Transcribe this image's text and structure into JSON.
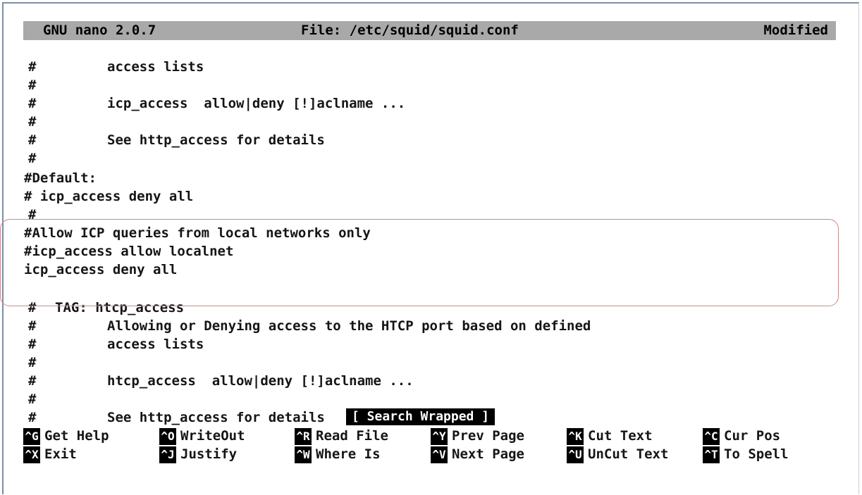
{
  "titlebar": {
    "version": "GNU nano 2.0.7",
    "file": "File: /etc/squid/squid.conf",
    "status": "Modified"
  },
  "lines": [
    {
      "hash": "#",
      "indent": "tab",
      "text": "access lists"
    },
    {
      "hash": "#",
      "indent": "none",
      "text": ""
    },
    {
      "hash": "#",
      "indent": "tab",
      "text": "icp_access  allow|deny [!]aclname ..."
    },
    {
      "hash": "#",
      "indent": "none",
      "text": ""
    },
    {
      "hash": "#",
      "indent": "tab",
      "text": "See http_access for details"
    },
    {
      "hash": "#",
      "indent": "none",
      "text": ""
    },
    {
      "hash": "",
      "indent": "none",
      "text": "#Default:"
    },
    {
      "hash": "",
      "indent": "none",
      "text": "# icp_access deny all"
    },
    {
      "hash": "#",
      "indent": "none",
      "text": ""
    },
    {
      "hash": "",
      "indent": "none",
      "text": "#Allow ICP queries from local networks only"
    },
    {
      "hash": "",
      "indent": "none",
      "text": "#icp_access allow localnet"
    },
    {
      "hash": "",
      "indent": "none",
      "text": "icp_access deny all"
    },
    {
      "hash": "",
      "indent": "none",
      "text": ""
    },
    {
      "hash": "#",
      "indent": "small",
      "text": "TAG: htcp_access"
    },
    {
      "hash": "#",
      "indent": "tab",
      "text": "Allowing or Denying access to the HTCP port based on defined"
    },
    {
      "hash": "#",
      "indent": "tab",
      "text": "access lists"
    },
    {
      "hash": "#",
      "indent": "none",
      "text": ""
    },
    {
      "hash": "#",
      "indent": "tab",
      "text": "htcp_access  allow|deny [!]aclname ..."
    },
    {
      "hash": "#",
      "indent": "none",
      "text": ""
    },
    {
      "hash": "#",
      "indent": "tab",
      "text": "See http_access for details"
    }
  ],
  "status_message": "[ Search Wrapped ]",
  "shortcuts_row1": [
    {
      "key": "^G",
      "label": "Get Help"
    },
    {
      "key": "^O",
      "label": "WriteOut"
    },
    {
      "key": "^R",
      "label": "Read File"
    },
    {
      "key": "^Y",
      "label": "Prev Page"
    },
    {
      "key": "^K",
      "label": "Cut Text"
    },
    {
      "key": "^C",
      "label": "Cur Pos"
    }
  ],
  "shortcuts_row2": [
    {
      "key": "^X",
      "label": "Exit"
    },
    {
      "key": "^J",
      "label": "Justify"
    },
    {
      "key": "^W",
      "label": "Where Is"
    },
    {
      "key": "^V",
      "label": "Next Page"
    },
    {
      "key": "^U",
      "label": "UnCut Text"
    },
    {
      "key": "^T",
      "label": "To Spell"
    }
  ]
}
